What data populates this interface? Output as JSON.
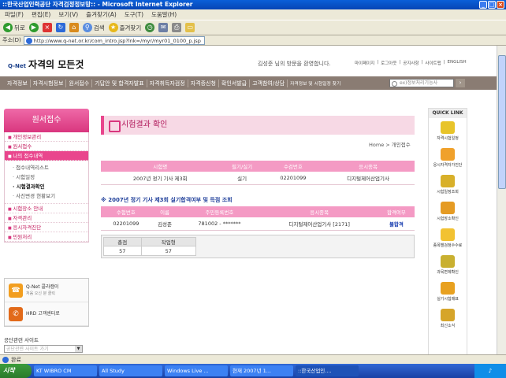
{
  "window": {
    "title": "::한국산업인력공단 자격검정정보망:: - Microsoft Internet Explorer"
  },
  "menu": [
    "파일(F)",
    "편집(E)",
    "보기(V)",
    "즐겨찾기(A)",
    "도구(T)",
    "도움말(H)"
  ],
  "toolbar": {
    "back": "뒤로",
    "search": "검색",
    "favorites": "즐겨찾기"
  },
  "address": {
    "label": "주소(D)",
    "url": "http://www.q-net.or.kr/com_intro.jsp?lnk=/myr/myr01_0100_p.jsp"
  },
  "site": {
    "logo_small": "Q-Net",
    "logo_text": "자격의 모든것",
    "welcome": "김성준 님의 방문을 환영합니다.",
    "toplinks": [
      "마이페이지",
      "로그아웃",
      "공지사항",
      "사이트맵",
      "ENGLISH"
    ]
  },
  "gnb": [
    "자격정보",
    "자격시험정보",
    "원서접수",
    "기사합격",
    "자격취득자검정",
    "자격증신청",
    "확인서발급",
    "고객참여/상담"
  ],
  "gnb_small": "자격정보 및 시험일정 찾기",
  "gnb_alt_labels": [
    "기답안 및 합격자발표"
  ],
  "search_placeholder": "ex)정보처리기능사",
  "lnb": {
    "title": "원서접수",
    "items": [
      "개인정보관리",
      "원서접수",
      "나의 접수내역"
    ],
    "subs": [
      "접수내역리스트",
      "시험일정",
      "시험결과확인",
      "사진변경 현황보기"
    ],
    "items2": [
      "시험장소 안내",
      "자격관리",
      "응시자격진단",
      "민원처리"
    ]
  },
  "banner": {
    "callcenter": "Q-Net 콜라캠이",
    "callcenter_sub": "처음 오신 분 클릭",
    "hrd": "HRD 고객센터로"
  },
  "related": {
    "label": "공단관련 사이트",
    "select": "공단관련 사이트 가기"
  },
  "content": {
    "title": "시험결과 확인",
    "breadcrumb": "Home > 개인접수",
    "table1": {
      "headers": [
        "시험명",
        "필기/실기",
        "수검번호",
        "응시종목"
      ],
      "row": [
        "2007년 정기 기사 제3회",
        "실기",
        "02201099",
        "디지털제어산업기사"
      ]
    },
    "subtitle": "※ 2007년 정기 기사 제3회 실기합격여부 및 득점 조회",
    "table2": {
      "headers": [
        "수험번호",
        "이름",
        "주민등록번호",
        "응시종목",
        "합격여부"
      ],
      "row": [
        "02201099",
        "김성준",
        "781002 - *******",
        "디지털제어산업기사 [2171]",
        "불합격"
      ]
    },
    "table3": {
      "headers": [
        "총점",
        "작업형"
      ],
      "row": [
        "57",
        "57"
      ]
    }
  },
  "quick": {
    "title": "QUICK LINK",
    "items": [
      "자격시험일정",
      "응시자격자가진단",
      "시험일정조회",
      "시험장소확인",
      "종목별검정수수료",
      "과목면제확인",
      "실기시험매표",
      "최신소식"
    ]
  },
  "status": "완료",
  "taskbar": {
    "start": "시작",
    "tasks": [
      "KT WIBRO CM",
      "All Study",
      "Windows Live ...",
      "현재 2007년 1...",
      "::한국산업인...."
    ]
  },
  "colors": {
    "pink": "#e9468d",
    "pink_light": "#f49ac4",
    "gnb": "#8a7c73",
    "pass_blue": "#1a3fb0"
  }
}
